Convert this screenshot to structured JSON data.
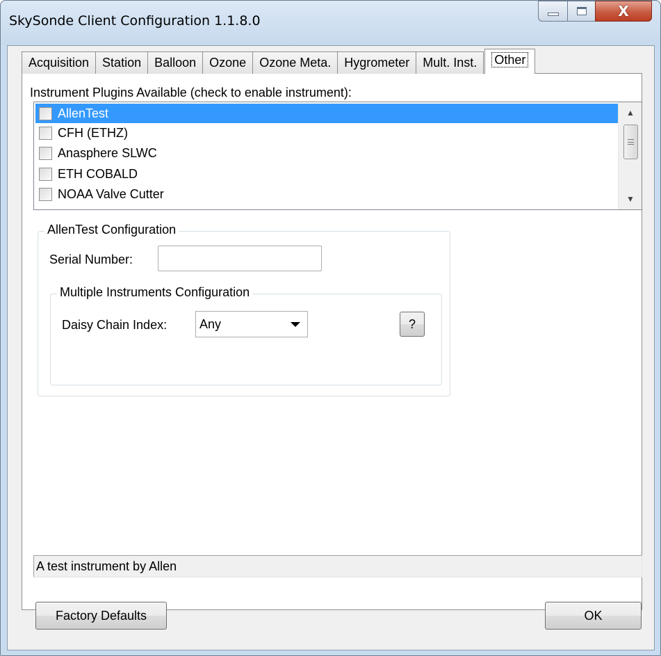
{
  "window": {
    "title": "SkySonde Client Configuration 1.1.8.0",
    "close_glyph": "X"
  },
  "tabs": [
    {
      "label": "Acquisition"
    },
    {
      "label": "Station"
    },
    {
      "label": "Balloon"
    },
    {
      "label": "Ozone"
    },
    {
      "label": "Ozone Meta."
    },
    {
      "label": "Hygrometer"
    },
    {
      "label": "Mult. Inst."
    },
    {
      "label": "Other",
      "active": true
    }
  ],
  "plugins": {
    "label": "Instrument Plugins Available (check to enable instrument):",
    "items": [
      {
        "label": "AllenTest",
        "checked": false,
        "selected": true
      },
      {
        "label": "CFH (ETHZ)",
        "checked": false
      },
      {
        "label": "Anasphere SLWC",
        "checked": false
      },
      {
        "label": "ETH COBALD",
        "checked": false
      },
      {
        "label": "NOAA Valve Cutter",
        "checked": false
      }
    ]
  },
  "config": {
    "group_title": "AllenTest Configuration",
    "serial_label": "Serial Number:",
    "serial_value": "",
    "multi_group_title": "Multiple Instruments Configuration",
    "daisy_label": "Daisy Chain Index:",
    "daisy_value": "Any",
    "help_label": "?"
  },
  "status": {
    "text": "A test instrument by Allen"
  },
  "footer": {
    "factory_label": "Factory Defaults",
    "ok_label": "OK"
  },
  "icons": {
    "minimize": "minimize-icon",
    "maximize": "maximize-icon",
    "close": "close-icon",
    "scroll_up": "scroll-up-arrow-icon",
    "scroll_down": "scroll-down-arrow-icon",
    "dropdown": "chevron-down-icon"
  }
}
